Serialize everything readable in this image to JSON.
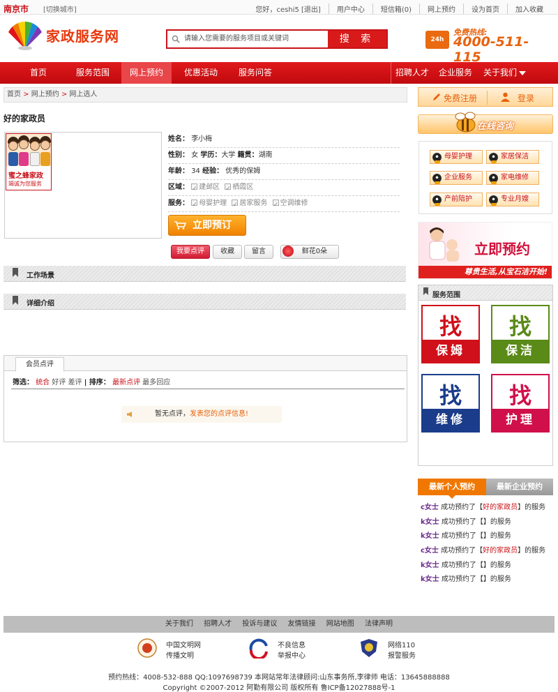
{
  "topbar": {
    "city": "南京市",
    "switch_city": "[切换城市]",
    "greeting": "您好，ceshi5 [退出]",
    "links": [
      "用户中心",
      "短信箱(0)",
      "网上预约",
      "设为首页",
      "加入收藏"
    ]
  },
  "header": {
    "logo_text": "家政服务网",
    "search_placeholder": "请输入您需要的服务项目或关键词",
    "search_button": "搜 索",
    "hotline_label": "免费热线:",
    "hotline_number": "4000-511-115",
    "hotline_badge": "24h"
  },
  "nav": {
    "items": [
      "首页",
      "服务范围",
      "网上预约",
      "优惠活动",
      "服务问答"
    ],
    "right_items": [
      "招聘人才",
      "企业服务",
      "关于我们"
    ],
    "active": "网上预约"
  },
  "breadcrumb": [
    "首页",
    "网上预约",
    "网上选人"
  ],
  "page_title": "好的家政员",
  "photo": {
    "caption1": "蜜之蜂家政",
    "caption2": "竭诚为您服务"
  },
  "info": {
    "name_label": "姓名：",
    "name": "李小梅",
    "gender_label": "性别：",
    "gender": "女",
    "edu_label": "学历：",
    "edu": "大学",
    "native_label": "籍贯：",
    "native": "湖南",
    "age_label": "年龄：",
    "age": "34",
    "exp_label": "经验：",
    "exp": "优秀的保姆",
    "area_label": "区域：",
    "areas": [
      "建邺区",
      "栖霞区"
    ],
    "service_label": "服务：",
    "services": [
      "母婴护理",
      "居家服务",
      "空调维修"
    ]
  },
  "book_button": "立即预订",
  "actions": {
    "review": "我要点评",
    "favorite": "收藏",
    "message": "留言",
    "flower": "鲜花0朵"
  },
  "sections": {
    "work_scene": "工作场景",
    "detail": "详细介绍"
  },
  "reviews": {
    "tab": "会员点评",
    "filter_label": "筛选：",
    "filter_all": "统合",
    "filter_good": "好评",
    "filter_bad": "差评",
    "sort_label": "| 排序：",
    "sort_new": "最新点评",
    "sort_reply": "最多回应",
    "empty_text": "暂无点评，",
    "empty_link": "发表您的点评信息!"
  },
  "sidebar": {
    "register": "免费注册",
    "login": "登录",
    "consult": "在线咨询",
    "qq_items": [
      "母婴护理",
      "家居保洁",
      "企业服务",
      "家电维修",
      "产前陪护",
      "专业月嫂"
    ],
    "banner_title": "立即预约",
    "banner_slogan": "尊贵生活,从宝石洁开始!",
    "service_scope_title": "服务范围",
    "find_char": "找",
    "find_items": [
      {
        "label": "保姆",
        "color": "#d0101a"
      },
      {
        "label": "保洁",
        "color": "#5a8a18"
      },
      {
        "label": "维修",
        "color": "#1a3c8a"
      },
      {
        "label": "护理",
        "color": "#d0104a"
      }
    ],
    "latest_tab1": "最新个人预约",
    "latest_tab2": "最新企业预约",
    "latest": [
      {
        "name": "c女士",
        "pre": "成功预约了【",
        "item": "好的家政员",
        "post": "】的服务"
      },
      {
        "name": "k女士",
        "pre": "成功预约了【",
        "item": "",
        "post": "】的服务"
      },
      {
        "name": "k女士",
        "pre": "成功预约了【",
        "item": "",
        "post": "】的服务"
      },
      {
        "name": "c女士",
        "pre": "成功预约了【",
        "item": "好的家政员",
        "post": "】的服务"
      },
      {
        "name": "k女士",
        "pre": "成功预约了【",
        "item": "",
        "post": "】的服务"
      },
      {
        "name": "k女士",
        "pre": "成功预约了【",
        "item": "",
        "post": "】的服务"
      }
    ]
  },
  "footer": {
    "links": [
      "关于我们",
      "招聘人才",
      "投诉与建议",
      "友情链接",
      "网站地图",
      "法律声明"
    ],
    "badges": [
      {
        "l1": "中国文明网",
        "l2": "传播文明"
      },
      {
        "l1": "不良信息",
        "l2": "举报中心"
      },
      {
        "l1": "网络110",
        "l2": "报警服务"
      }
    ],
    "info1": "预约热线：4008-532-888  QQ:1097698739  本网站常年法律顾问:山东事务所,李律师  电话：13645888888",
    "info2": "Copyright ©2007-2012  阿勤有限公司  版权所有  鲁ICP备12027888号-1"
  }
}
